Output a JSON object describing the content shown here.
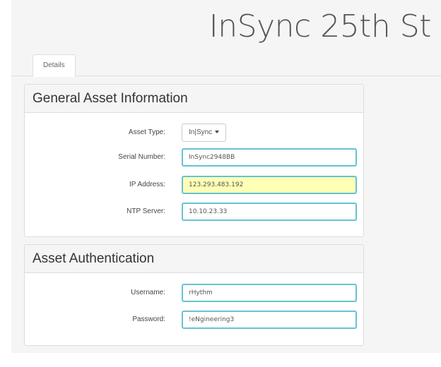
{
  "page": {
    "title": "InSync 25th St"
  },
  "tabs": [
    {
      "label": "Details",
      "active": true
    }
  ],
  "general": {
    "heading": "General Asset Information",
    "asset_type": {
      "label": "Asset Type:",
      "value": "In|Sync"
    },
    "serial_number": {
      "label": "Serial Number:",
      "value": "InSync2948BB"
    },
    "ip_address": {
      "label": "IP Address:",
      "value": "123.293.483.192"
    },
    "ntp_server": {
      "label": "NTP Server:",
      "value": "10.10.23.33"
    }
  },
  "auth": {
    "heading": "Asset Authentication",
    "username": {
      "label": "Username:",
      "value": "rHythm"
    },
    "password": {
      "label": "Password:",
      "value": "!eNgineering3"
    }
  },
  "colors": {
    "field_border": "#66c2d4",
    "highlight_bg": "#ffffb5",
    "page_bg": "#f5f5f5"
  },
  "icons": {
    "dropdown_caret": "caret-down-icon"
  }
}
